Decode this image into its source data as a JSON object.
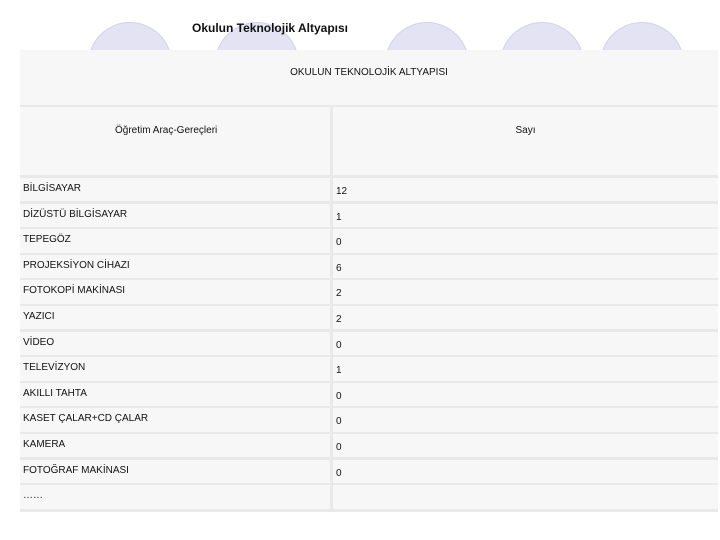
{
  "slide": {
    "title": "Okulun Teknolojik Altyapısı"
  },
  "table": {
    "title": "OKULUN TEKNOLOJİK ALTYAPISI",
    "headers": [
      "Öğretim Araç-Gereçleri",
      "Sayı"
    ],
    "rows": [
      {
        "item": "BİLGİSAYAR",
        "count": "12"
      },
      {
        "item": "DİZÜSTÜ BİLGİSAYAR",
        "count": "1"
      },
      {
        "item": "TEPEGÖZ",
        "count": "0"
      },
      {
        "item": "PROJEKSİYON CİHAZI",
        "count": "6"
      },
      {
        "item": "FOTOKOPİ MAKİNASI",
        "count": "2"
      },
      {
        "item": "YAZICI",
        "count": "2"
      },
      {
        "item": "VİDEO",
        "count": "0"
      },
      {
        "item": "TELEVİZYON",
        "count": "1"
      },
      {
        "item": "AKILLI TAHTA",
        "count": "0"
      },
      {
        "item": "KASET ÇALAR+CD ÇALAR",
        "count": "0"
      },
      {
        "item": "KAMERA",
        "count": "0"
      },
      {
        "item": "FOTOĞRAF MAKİNASI",
        "count": "0"
      },
      {
        "item": "……",
        "count": ""
      }
    ]
  }
}
